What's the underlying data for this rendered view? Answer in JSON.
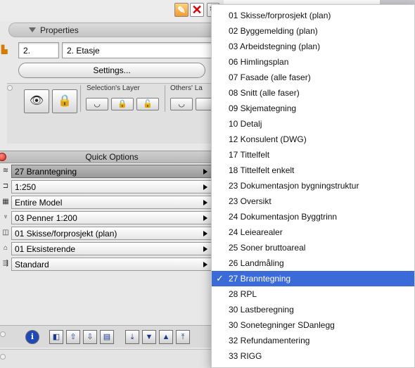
{
  "toolbar": {
    "icons": [
      "new-layout-icon",
      "delete-icon",
      "curl-icon"
    ],
    "delete_glyph": "✕"
  },
  "properties": {
    "title": "Properties",
    "story_number": "2.",
    "story_name": "2. Etasje",
    "settings_label": "Settings..."
  },
  "layers": {
    "selection_label": "Selection's Layer",
    "others_label": "Others' La"
  },
  "quick_options": {
    "title": "Quick Options",
    "rows": [
      {
        "label": "27 Branntegning",
        "icon": "layer-combination-icon",
        "glyph": "≋",
        "active": true
      },
      {
        "label": "1:250",
        "icon": "scale-icon",
        "glyph": "⊐",
        "active": false
      },
      {
        "label": "Entire Model",
        "icon": "structure-display-icon",
        "glyph": "▦",
        "active": false
      },
      {
        "label": "03 Penner 1:200",
        "icon": "pen-set-icon",
        "glyph": "♆",
        "active": false
      },
      {
        "label": "01 Skisse/forprosjekt (plan)",
        "icon": "model-view-options-icon",
        "glyph": "◫",
        "active": false
      },
      {
        "label": "01 Eksisterende",
        "icon": "renovation-filter-icon",
        "glyph": "⌂",
        "active": false
      },
      {
        "label": "Standard",
        "icon": "dimension-icon",
        "glyph": "⇶",
        "active": false
      }
    ]
  },
  "menu": {
    "selected_index": 17,
    "check_glyph": "✓",
    "items": [
      "01 Skisse/forprosjekt (plan)",
      "02 Byggemelding (plan)",
      "03 Arbeidstegning (plan)",
      "06 Himlingsplan",
      "07 Fasade (alle faser)",
      "08 Snitt (alle faser)",
      "09 Skjemategning",
      "10 Detalj",
      "12 Konsulent (DWG)",
      "17 Tittelfelt",
      "18 Tittelfelt enkelt",
      "23 Dokumentasjon bygningstruktur",
      "23 Oversikt",
      "24 Dokumentasjon Byggtrinn",
      "24 Leiearealer",
      "25 Soner bruttoareal",
      "26 Landmåling",
      "27 Branntegning",
      "28 RPL",
      "30 Lastberegning",
      "30 Sonetegninger SDanlegg",
      "32 Refundamentering",
      "33 RIGG"
    ]
  },
  "bottom_bar": {
    "buttons": [
      "info-icon",
      "view-icon",
      "up-icon",
      "down-icon",
      "list-icon",
      "first-icon",
      "prev-icon",
      "next-icon",
      "last-icon"
    ]
  },
  "colors": {
    "selection": "#3b6bd8",
    "close_dot": "#d0241b",
    "active_row": "#9a9a9a"
  }
}
